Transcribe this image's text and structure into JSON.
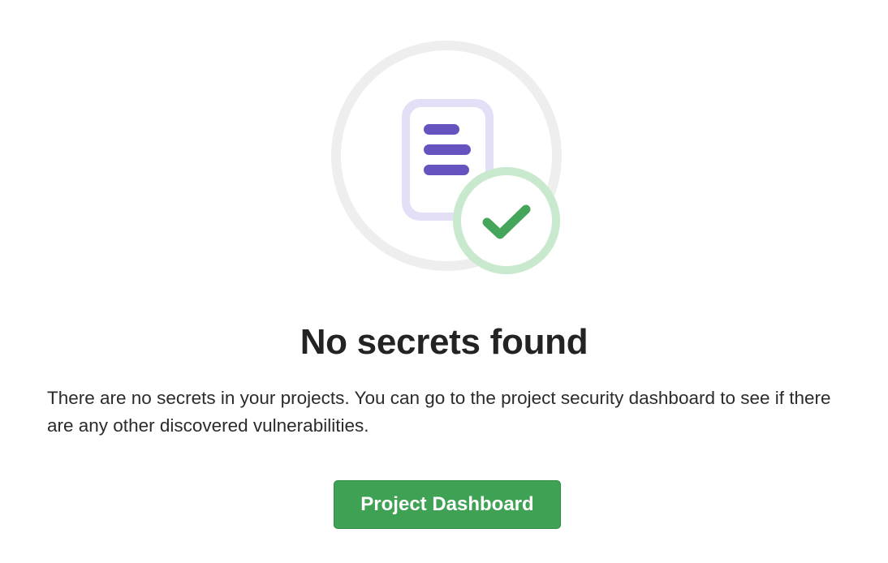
{
  "empty_state": {
    "illustration_icon": "document-checkmark-icon",
    "title": "No secrets found",
    "description": "There are no secrets in your projects. You can go to the project security dashboard to see if there are any other discovered vulnerabilities.",
    "action_label": "Project Dashboard"
  },
  "colors": {
    "primary_green": "#3fa154",
    "check_green": "#45a55a",
    "check_ring": "#c9e9cf",
    "document_purple": "#6753bf",
    "document_outline": "#e3dff7",
    "title_text": "#232323"
  }
}
